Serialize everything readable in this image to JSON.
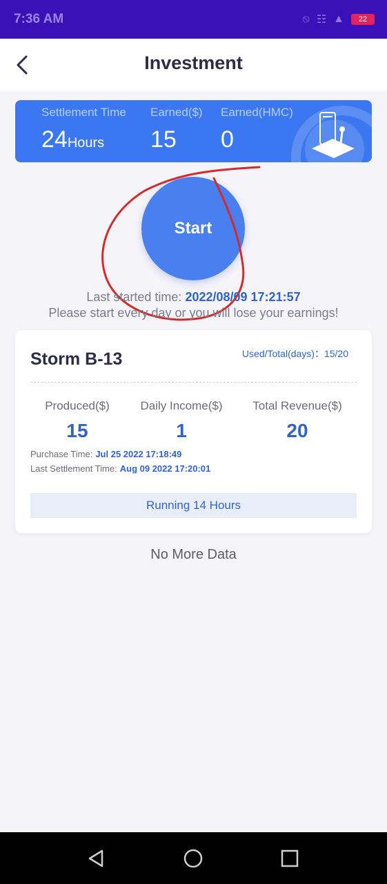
{
  "status_bar": {
    "time": "7:36 AM",
    "battery": "22"
  },
  "header": {
    "title": "Investment"
  },
  "banner": {
    "settlement_label": "Settlement Time",
    "settlement_value": "24",
    "settlement_unit": "Hours",
    "earned_usd_label": "Earned($)",
    "earned_usd_value": "15",
    "earned_hmc_label": "Earned(HMC)",
    "earned_hmc_value": "0"
  },
  "start_button": {
    "label": "Start"
  },
  "last_started": {
    "label": "Last started time:",
    "timestamp": "2022/08/09 17:21:57"
  },
  "warning": "Please start every day or you will lose your earnings!",
  "card": {
    "title": "Storm B-13",
    "used_total": "Used/Total(days)：15/20",
    "produced_label": "Produced($)",
    "produced_value": "15",
    "daily_income_label": "Daily Income($)",
    "daily_income_value": "1",
    "total_revenue_label": "Total Revenue($)",
    "total_revenue_value": "20",
    "purchase_time_label": "Purchase Time:",
    "purchase_time_value": "Jul 25 2022 17:18:49",
    "last_settlement_label": "Last Settlement Time:",
    "last_settlement_value": "Aug 09 2022 17:20:01",
    "running": "Running 14 Hours"
  },
  "footer_text": "No More Data",
  "colors": {
    "status_bar": "#3a10b8",
    "accent": "#3a77f0",
    "start_button": "#4a7ff0",
    "value_text": "#3163c7",
    "annotation": "#d32a2a"
  },
  "icons": [
    "back-arrow-icon",
    "wifi-icon",
    "signal-icon",
    "battery-icon",
    "nav-back-icon",
    "nav-home-icon",
    "nav-recents-icon"
  ]
}
